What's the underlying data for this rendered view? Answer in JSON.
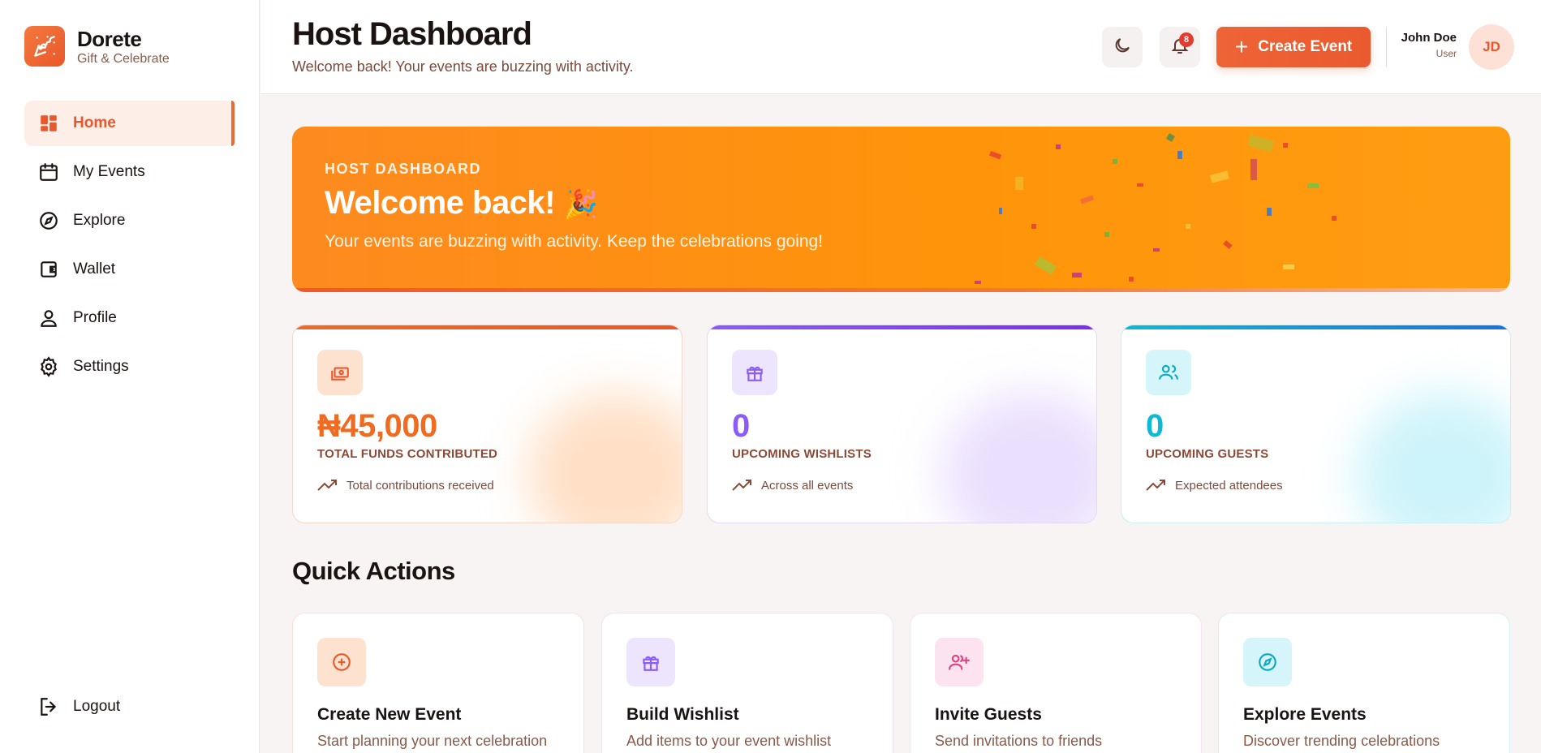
{
  "brand": {
    "name": "Dorete",
    "tagline": "Gift & Celebrate",
    "logo_icon": "party-popper-icon"
  },
  "sidebar": {
    "items": [
      {
        "label": "Home",
        "icon": "dashboard-icon",
        "active": true
      },
      {
        "label": "My Events",
        "icon": "calendar-icon",
        "active": false
      },
      {
        "label": "Explore",
        "icon": "compass-icon",
        "active": false
      },
      {
        "label": "Wallet",
        "icon": "wallet-icon",
        "active": false
      },
      {
        "label": "Profile",
        "icon": "user-icon",
        "active": false
      },
      {
        "label": "Settings",
        "icon": "gear-icon",
        "active": false
      }
    ],
    "logout": {
      "label": "Logout",
      "icon": "logout-icon"
    }
  },
  "header": {
    "title": "Host Dashboard",
    "subtitle": "Welcome back! Your events are buzzing with activity.",
    "theme_toggle_icon": "moon-icon",
    "notifications": {
      "icon": "bell-icon",
      "count": "8"
    },
    "create_button": "Create Event",
    "user": {
      "name": "John Doe",
      "role": "User",
      "initials": "JD"
    }
  },
  "hero": {
    "kicker": "HOST DASHBOARD",
    "title": "Welcome back!",
    "title_emoji": "🎉",
    "subtitle": "Your events are buzzing with activity. Keep the celebrations going!"
  },
  "stats": [
    {
      "value": "₦45,000",
      "label": "TOTAL FUNDS CONTRIBUTED",
      "note": "Total contributions received",
      "icon": "money-icon",
      "color": "#f06a1f"
    },
    {
      "value": "0",
      "label": "UPCOMING WISHLISTS",
      "note": "Across all events",
      "icon": "gift-icon",
      "color": "#8b5cf6"
    },
    {
      "value": "0",
      "label": "UPCOMING GUESTS",
      "note": "Expected attendees",
      "icon": "users-icon",
      "color": "#0fb8d4"
    }
  ],
  "quick_actions": {
    "title": "Quick Actions",
    "items": [
      {
        "title": "Create New Event",
        "desc": "Start planning your next celebration",
        "icon": "plus-circle-icon"
      },
      {
        "title": "Build Wishlist",
        "desc": "Add items to your event wishlist",
        "icon": "gift-icon"
      },
      {
        "title": "Invite Guests",
        "desc": "Send invitations to friends",
        "icon": "user-plus-icon"
      },
      {
        "title": "Explore Events",
        "desc": "Discover trending celebrations",
        "icon": "compass-icon"
      }
    ]
  },
  "colors": {
    "accent": "#e9572a",
    "hero": "#ff940a",
    "purple": "#8b5cf6",
    "cyan": "#0fb8d4"
  }
}
